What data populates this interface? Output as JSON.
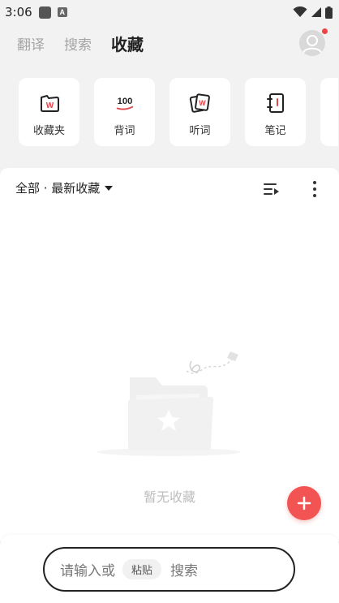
{
  "status_bar": {
    "time": "3:06",
    "app_badge": "A"
  },
  "top_tabs": [
    {
      "label": "翻译",
      "active": false
    },
    {
      "label": "搜索",
      "active": false
    },
    {
      "label": "收藏",
      "active": true
    }
  ],
  "tools": [
    {
      "label": "收藏夹",
      "icon": "folder-w-icon"
    },
    {
      "label": "背词",
      "icon": "hundred-icon",
      "icon_text": "100"
    },
    {
      "label": "听词",
      "icon": "cards-w-icon"
    },
    {
      "label": "笔记",
      "icon": "notebook-icon"
    }
  ],
  "filter": {
    "label": "全部 · 最新收藏"
  },
  "empty_state": {
    "text": "暂无收藏"
  },
  "search": {
    "prefix": "请输入或",
    "paste_label": "粘贴",
    "suffix": "搜索"
  },
  "colors": {
    "accent": "#f25454",
    "tool_icon_red": "#e0474c"
  }
}
